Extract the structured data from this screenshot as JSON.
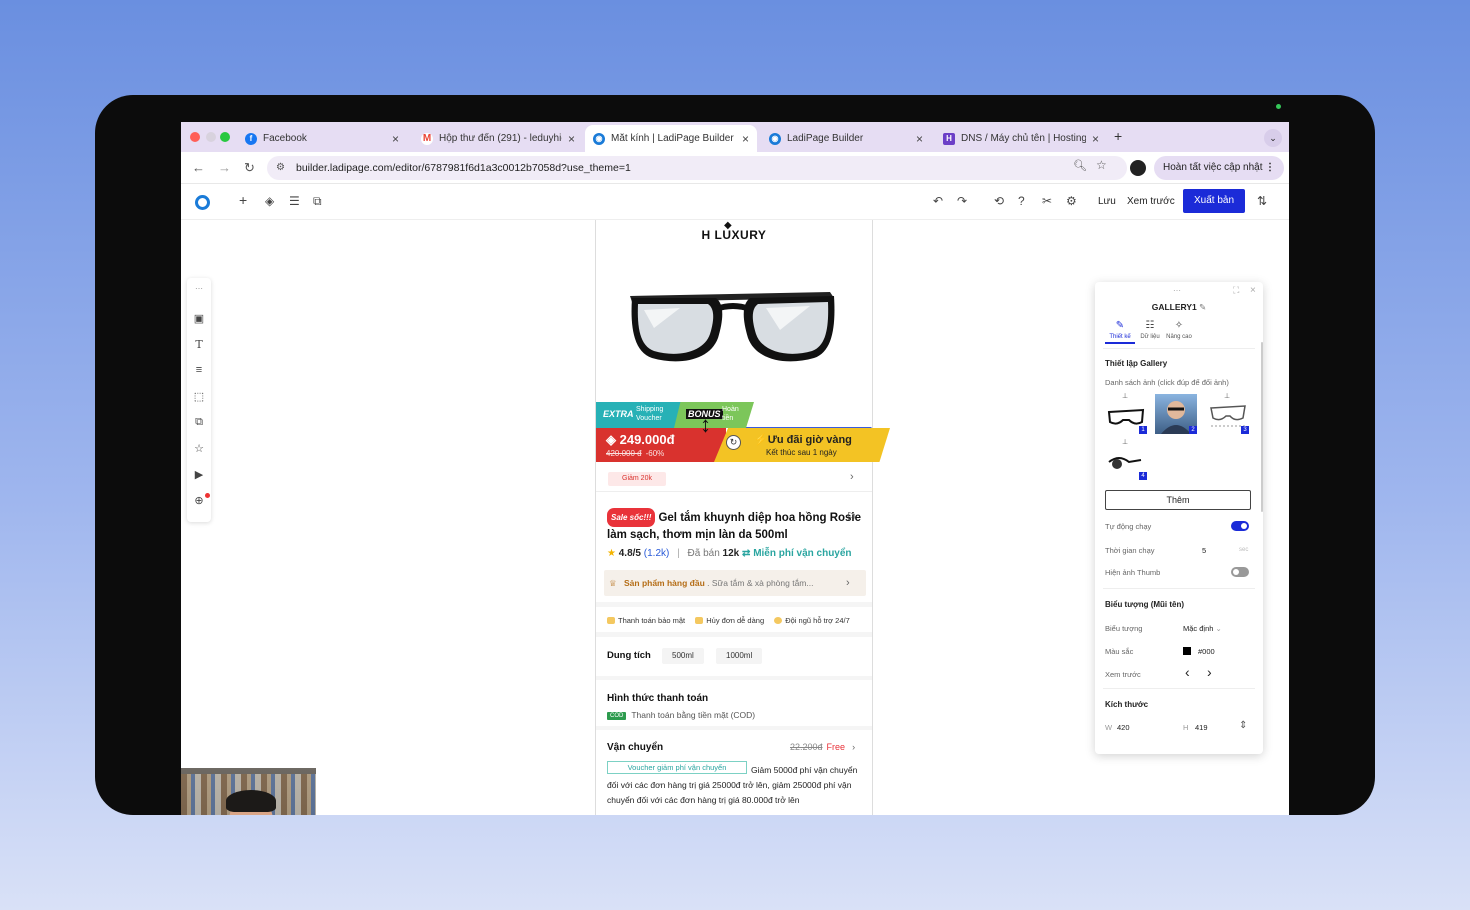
{
  "browser": {
    "tabs": [
      {
        "title": "Facebook",
        "color": "#1877f2"
      },
      {
        "title": "Hộp thư đến (291) - leduyhie",
        "color": "#ea4335"
      },
      {
        "title": "Mắt kính | LadiPage Builder",
        "color": "#1a7bd8"
      },
      {
        "title": "LadiPage Builder",
        "color": "#1a7bd8"
      },
      {
        "title": "DNS / Máy chủ tên | Hosting",
        "color": "#6c3fc7"
      }
    ],
    "url": "builder.ladipage.com/editor/6787981f6d1a3c0012b7058d?use_theme=1",
    "update_label": "Hoàn tất việc cập nhật"
  },
  "toolbar": {
    "save_label": "Lưu",
    "preview_label": "Xem trước",
    "publish_label": "Xuất bản",
    "accent": "#1b2bd8"
  },
  "product": {
    "brand": "H LUXURY",
    "extra_label": "EXTRA",
    "extra_sub": "Shipping Voucher",
    "bonus_label": "BONUS",
    "bonus_sub": "Hoàn tiền",
    "price": "249.000đ",
    "old_price": "420.000 đ",
    "discount": "-60%",
    "flash_title": "Ưu đãi giờ vàng",
    "flash_sub": "Kết thúc sau 1 ngày",
    "voucher": "Giảm 20k",
    "sale_chip": "Sale sốc!!!",
    "title": "Gel tắm khuynh diệp hoa hồng Rosie làm sạch, thơm mịn làn da 500ml",
    "rating": "4.8/5",
    "rating_count": "(1.2k)",
    "sold_label": "Đã bán",
    "sold_value": "12k",
    "free_ship": "Miễn phí vận chuyển",
    "top_label": "Sản phẩm hàng đầu",
    "top_category": ". Sữa tắm & xà phòng tắm...",
    "features": [
      "Thanh toán bảo mật",
      "Hủy đơn dễ dàng",
      "Đội ngũ hỗ trợ 24/7"
    ],
    "volume_label": "Dung tích",
    "volumes": [
      "500ml",
      "1000ml"
    ],
    "payment_label": "Hình thức thanh toán",
    "cod_chip": "COD",
    "payment_method": "Thanh toán bằng tiền mặt (COD)",
    "shipping_label": "Vận chuyển",
    "shipping_old": "22.200đ",
    "shipping_free": "Free",
    "shipping_voucher": "Voucher giảm phí vận chuyển",
    "shipping_desc": "Giảm 5000đ phí vận chuyển đối với các đơn hàng trị giá 25000đ trở lên, giảm 25000đ phí vận chuyển đối với các đơn hàng trị giá 80.000đ trở lên"
  },
  "panel": {
    "name": "GALLERY1",
    "tabs": [
      "Thiết kế",
      "Dữ liệu",
      "Nâng cao"
    ],
    "section_gallery": "Thiết lập Gallery",
    "image_list_hint": "Danh sách ảnh (click đúp để đổi ảnh)",
    "thumb_numbers": [
      "1",
      "2",
      "3",
      "4"
    ],
    "add_button": "Thêm",
    "autoplay_label": "Tự động chạy",
    "autoplay_on": true,
    "duration_label": "Thời gian chạy",
    "duration_value": "5",
    "duration_unit": "sec",
    "thumb_label": "Hiện ảnh Thumb",
    "thumb_on": false,
    "section_arrow": "Biểu tượng (Mũi tên)",
    "icon_label": "Biểu tượng",
    "icon_value": "Mặc định",
    "color_label": "Màu sắc",
    "color_value": "#000",
    "preview_label": "Xem trước",
    "section_size": "Kích thước",
    "w_label": "W",
    "w_value": "420",
    "h_label": "H",
    "h_value": "419"
  }
}
